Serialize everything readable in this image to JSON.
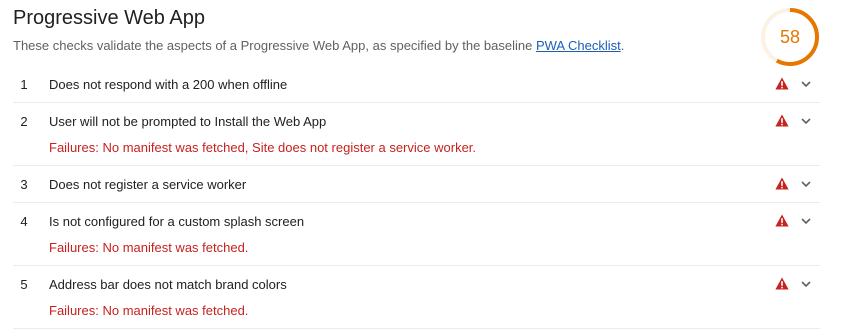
{
  "header": {
    "title": "Progressive Web App",
    "description": "These checks validate the aspects of a Progressive Web App, as specified by the baseline ",
    "link_label": "PWA Checklist",
    "description_suffix": "."
  },
  "score": {
    "value": "58",
    "fraction": 0.58,
    "color": "#e67700"
  },
  "audits": [
    {
      "index": "1",
      "title": "Does not respond with a 200 when offline",
      "failure": ""
    },
    {
      "index": "2",
      "title": "User will not be prompted to Install the Web App",
      "failure": "Failures: No manifest was fetched, Site does not register a service worker."
    },
    {
      "index": "3",
      "title": "Does not register a service worker",
      "failure": ""
    },
    {
      "index": "4",
      "title": "Is not configured for a custom splash screen",
      "failure": "Failures: No manifest was fetched."
    },
    {
      "index": "5",
      "title": "Address bar does not match brand colors",
      "failure": "Failures: No manifest was fetched."
    }
  ],
  "colors": {
    "fail": "#c7221f",
    "average": "#e67700"
  },
  "icons": {
    "status": "warning-triangle-icon",
    "expand": "chevron-down-icon"
  }
}
